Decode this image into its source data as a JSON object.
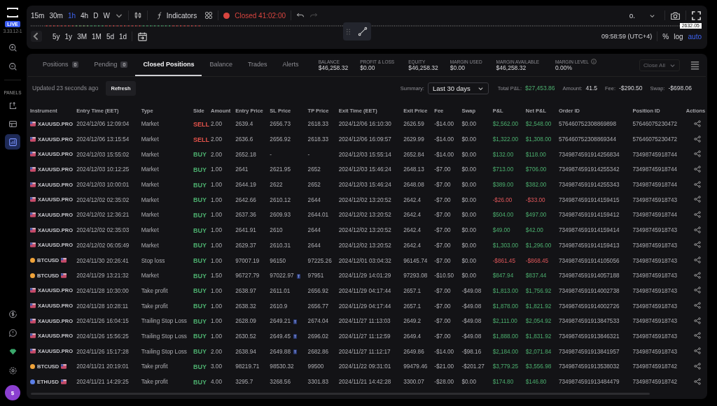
{
  "sidebar": {
    "badge": "LIVE",
    "version": "3.33.12-1",
    "section_label": "PANELS",
    "panel_items": [
      {
        "selected": false
      },
      {
        "selected": false
      },
      {
        "selected": true
      }
    ],
    "account": "$"
  },
  "toolbar": {
    "timeframes": [
      {
        "label": "15m",
        "selected": false
      },
      {
        "label": "30m",
        "selected": false
      },
      {
        "label": "1h",
        "selected": true
      },
      {
        "label": "4h",
        "selected": false
      },
      {
        "label": "D",
        "selected": false
      },
      {
        "label": "W",
        "selected": false
      }
    ],
    "indicators": "Indicators",
    "market_status": "Closed 41:02:00",
    "symbol_select": "o.",
    "price_label": "2632.05",
    "ranges": [
      "5y",
      "1y",
      "3M",
      "1M",
      "5d",
      "1d"
    ],
    "clock": "09:58:59 (UTC+4)",
    "scale_options": [
      {
        "label": "%",
        "selected": false
      },
      {
        "label": "log",
        "selected": false
      },
      {
        "label": "auto",
        "selected": true
      }
    ]
  },
  "panel": {
    "tabs": [
      {
        "label": "Positions",
        "count": "0",
        "selected": false
      },
      {
        "label": "Pending",
        "count": "0",
        "selected": false
      },
      {
        "label": "Closed Positions",
        "selected": true
      },
      {
        "label": "Balance",
        "selected": false
      },
      {
        "label": "Trades",
        "selected": false
      },
      {
        "label": "Alerts",
        "selected": false
      }
    ],
    "stats": [
      {
        "label": "BALANCE",
        "value": "$46,258.32"
      },
      {
        "label": "PROFIT & LOSS",
        "value": "$0.00"
      },
      {
        "label": "EQUITY",
        "value": "$46,258.32"
      },
      {
        "label": "MARGIN USED",
        "value": "$0.00"
      },
      {
        "label": "MARGIN AVAILABLE",
        "value": "$46,258.32"
      },
      {
        "label": "MARGIN LEVEL",
        "value": "0.00%",
        "info": true
      }
    ],
    "close_all": {
      "label": "Close All",
      "disabled": true
    },
    "updated": "Updated 23 seconds ago",
    "refresh": "Refresh",
    "summary": {
      "label": "Summary:",
      "period": "Last 30 days",
      "items": [
        {
          "label": "Total P&L:",
          "value": "$27,453.86",
          "positive": true
        },
        {
          "label": "Amount:",
          "value": "41.5",
          "positive": false
        },
        {
          "label": "Fee:",
          "value": "-$290.50",
          "positive": false
        },
        {
          "label": "Swap:",
          "value": "-$698.06",
          "positive": false
        }
      ]
    }
  },
  "table": {
    "columns": [
      "Instrument",
      "Entry Time (EET)",
      "Type",
      "Side",
      "Amount",
      "Entry Price",
      "SL Price",
      "TP Price",
      "Exit Time (EET)",
      "Exit Price",
      "Fee",
      "Swap",
      "P&L",
      "Net P&L",
      "Order ID",
      "Position ID",
      "Actions"
    ],
    "rows": [
      {
        "instrument": "XAUUSD.PRO",
        "kind": "metal",
        "entry_time": "2024/12/06 12:09:04",
        "type": "Market",
        "side": {
          "label": "SELL",
          "color": "#e5534b"
        },
        "amount": "2.00",
        "entry_price": "2639.4",
        "sl": "2656.73",
        "trailing": false,
        "tp": "2618.33",
        "exit_time": "2024/12/06 16:10:30",
        "exit_price": "2626.59",
        "fee": "-$14.00",
        "swap": "$0.00",
        "pnl": "$2,562.00",
        "net_pnl": "$2,548.00",
        "loss": false,
        "order_id": "576460752308869898",
        "position_id": "57646075230472"
      },
      {
        "instrument": "XAUUSD.PRO",
        "kind": "metal",
        "entry_time": "2024/12/06 13:15:54",
        "type": "Market",
        "side": {
          "label": "SELL",
          "color": "#e5534b"
        },
        "amount": "2.00",
        "entry_price": "2636.6",
        "sl": "2656.92",
        "trailing": false,
        "tp": "2618.33",
        "exit_time": "2024/12/06 16:09:57",
        "exit_price": "2629.99",
        "fee": "-$14.00",
        "swap": "$0.00",
        "pnl": "$1,322.00",
        "net_pnl": "$1,308.00",
        "loss": false,
        "order_id": "576460752308869344",
        "position_id": "57646075230472"
      },
      {
        "instrument": "XAUUSD.PRO",
        "kind": "metal",
        "entry_time": "2024/12/03 15:55:02",
        "type": "Market",
        "side": {
          "label": "BUY",
          "color": "#4cae6e"
        },
        "amount": "2.00",
        "entry_price": "2652.18",
        "sl": "-",
        "trailing": false,
        "tp": "-",
        "exit_time": "2024/12/03 15:55:14",
        "exit_price": "2652.84",
        "fee": "-$14.00",
        "swap": "$0.00",
        "pnl": "$132.00",
        "net_pnl": "$118.00",
        "loss": false,
        "order_id": "7349874591914256834",
        "position_id": "73498745918744"
      },
      {
        "instrument": "XAUUSD.PRO",
        "kind": "metal",
        "entry_time": "2024/12/03 10:12:25",
        "type": "Market",
        "side": {
          "label": "BUY",
          "color": "#4cae6e"
        },
        "amount": "1.00",
        "entry_price": "2641",
        "sl": "2621.95",
        "trailing": false,
        "tp": "2652",
        "exit_time": "2024/12/03 15:46:24",
        "exit_price": "2648.13",
        "fee": "-$7.00",
        "swap": "$0.00",
        "pnl": "$713.00",
        "net_pnl": "$706.00",
        "loss": false,
        "order_id": "7349874591914255342",
        "position_id": "73498745918744"
      },
      {
        "instrument": "XAUUSD.PRO",
        "kind": "metal",
        "entry_time": "2024/12/03 10:00:01",
        "type": "Market",
        "side": {
          "label": "BUY",
          "color": "#4cae6e"
        },
        "amount": "1.00",
        "entry_price": "2644.19",
        "sl": "2622",
        "trailing": false,
        "tp": "2652",
        "exit_time": "2024/12/03 15:46:24",
        "exit_price": "2648.08",
        "fee": "-$7.00",
        "swap": "$0.00",
        "pnl": "$389.00",
        "net_pnl": "$382.00",
        "loss": false,
        "order_id": "7349874591914255343",
        "position_id": "73498745918744"
      },
      {
        "instrument": "XAUUSD.PRO",
        "kind": "metal",
        "entry_time": "2024/12/02 02:35:02",
        "type": "Market",
        "side": {
          "label": "BUY",
          "color": "#4cae6e"
        },
        "amount": "1.00",
        "entry_price": "2642.66",
        "sl": "2610.12",
        "trailing": false,
        "tp": "2644",
        "exit_time": "2024/12/02 13:20:52",
        "exit_price": "2642.4",
        "fee": "-$7.00",
        "swap": "$0.00",
        "pnl": "-$26.00",
        "net_pnl": "-$33.00",
        "loss": true,
        "order_id": "7349874591914159415",
        "position_id": "73498745918743"
      },
      {
        "instrument": "XAUUSD.PRO",
        "kind": "metal",
        "entry_time": "2024/12/02 12:36:21",
        "type": "Market",
        "side": {
          "label": "BUY",
          "color": "#4cae6e"
        },
        "amount": "1.00",
        "entry_price": "2637.36",
        "sl": "2609.93",
        "trailing": false,
        "tp": "2644.01",
        "exit_time": "2024/12/02 13:20:52",
        "exit_price": "2642.4",
        "fee": "-$7.00",
        "swap": "$0.00",
        "pnl": "$504.00",
        "net_pnl": "$497.00",
        "loss": false,
        "order_id": "7349874591914159412",
        "position_id": "73498745918744"
      },
      {
        "instrument": "XAUUSD.PRO",
        "kind": "metal",
        "entry_time": "2024/12/02 02:35:03",
        "type": "Market",
        "side": {
          "label": "BUY",
          "color": "#4cae6e"
        },
        "amount": "1.00",
        "entry_price": "2641.91",
        "sl": "2610",
        "trailing": false,
        "tp": "2644",
        "exit_time": "2024/12/02 13:20:52",
        "exit_price": "2642.4",
        "fee": "-$7.00",
        "swap": "$0.00",
        "pnl": "$49.00",
        "net_pnl": "$42.00",
        "loss": false,
        "order_id": "7349874591914159414",
        "position_id": "73498745918743"
      },
      {
        "instrument": "XAUUSD.PRO",
        "kind": "metal",
        "entry_time": "2024/12/02 06:05:49",
        "type": "Market",
        "side": {
          "label": "BUY",
          "color": "#4cae6e"
        },
        "amount": "1.00",
        "entry_price": "2629.37",
        "sl": "2610.31",
        "trailing": false,
        "tp": "2644",
        "exit_time": "2024/12/02 13:20:52",
        "exit_price": "2642.4",
        "fee": "-$7.00",
        "swap": "$0.00",
        "pnl": "$1,303.00",
        "net_pnl": "$1,296.00",
        "loss": false,
        "order_id": "7349874591914159413",
        "position_id": "73498745918743"
      },
      {
        "instrument": "BTCUSD",
        "kind": "crypto",
        "color": "#f0a33a",
        "entry_time": "2024/11/30 20:26:41",
        "type": "Stop loss",
        "side": {
          "label": "BUY",
          "color": "#4cae6e"
        },
        "amount": "1.00",
        "entry_price": "97007.19",
        "sl": "96150",
        "trailing": false,
        "tp": "97225.26",
        "exit_time": "2024/12/01 03:04:32",
        "exit_price": "96145.74",
        "fee": "-$7.00",
        "swap": "$0.00",
        "pnl": "-$861.45",
        "net_pnl": "-$868.45",
        "loss": true,
        "order_id": "7349874591914105056",
        "position_id": "73498745918743"
      },
      {
        "instrument": "BTCUSD",
        "kind": "crypto",
        "color": "#f0a33a",
        "entry_time": "2024/11/29 13:21:32",
        "type": "Market",
        "side": {
          "label": "BUY",
          "color": "#4cae6e"
        },
        "amount": "1.50",
        "entry_price": "96727.79",
        "sl": "97022.97",
        "trailing": true,
        "tp": "97951",
        "exit_time": "2024/11/29 14:01:29",
        "exit_price": "97293.08",
        "fee": "-$10.50",
        "swap": "$0.00",
        "pnl": "$847.94",
        "net_pnl": "$837.44",
        "loss": false,
        "order_id": "7349874591914057188",
        "position_id": "73498745918743"
      },
      {
        "instrument": "XAUUSD.PRO",
        "kind": "metal",
        "entry_time": "2024/11/28 10:30:00",
        "type": "Take profit",
        "side": {
          "label": "BUY",
          "color": "#4cae6e"
        },
        "amount": "1.00",
        "entry_price": "2638.97",
        "sl": "2611.01",
        "trailing": false,
        "tp": "2656.92",
        "exit_time": "2024/11/29 04:17:44",
        "exit_price": "2657.1",
        "fee": "-$7.00",
        "swap": "-$49.08",
        "pnl": "$1,813.00",
        "net_pnl": "$1,756.92",
        "loss": false,
        "order_id": "7349874591914002738",
        "position_id": "73498745918743"
      },
      {
        "instrument": "XAUUSD.PRO",
        "kind": "metal",
        "entry_time": "2024/11/28 10:28:11",
        "type": "Take profit",
        "side": {
          "label": "BUY",
          "color": "#4cae6e"
        },
        "amount": "1.00",
        "entry_price": "2638.32",
        "sl": "2610.9",
        "trailing": false,
        "tp": "2656.77",
        "exit_time": "2024/11/29 04:17:44",
        "exit_price": "2657.1",
        "fee": "-$7.00",
        "swap": "-$49.08",
        "pnl": "$1,878.00",
        "net_pnl": "$1,821.92",
        "loss": false,
        "order_id": "7349874591914002726",
        "position_id": "73498745918743"
      },
      {
        "instrument": "XAUUSD.PRO",
        "kind": "metal",
        "entry_time": "2024/11/26 16:04:15",
        "type": "Trailing Stop Loss",
        "side": {
          "label": "BUY",
          "color": "#4cae6e"
        },
        "amount": "1.00",
        "entry_price": "2628.09",
        "sl": "2649.21",
        "trailing": true,
        "tp": "2674.04",
        "exit_time": "2024/11/27 11:13:03",
        "exit_price": "2649.2",
        "fee": "-$7.00",
        "swap": "-$49.08",
        "pnl": "$2,111.00",
        "net_pnl": "$2,054.92",
        "loss": false,
        "order_id": "7349874591913847533",
        "position_id": "73498745918743"
      },
      {
        "instrument": "XAUUSD.PRO",
        "kind": "metal",
        "entry_time": "2024/11/26 15:56:25",
        "type": "Trailing Stop Loss",
        "side": {
          "label": "BUY",
          "color": "#4cae6e"
        },
        "amount": "1.00",
        "entry_price": "2630.52",
        "sl": "2649.45",
        "trailing": true,
        "tp": "2696.02",
        "exit_time": "2024/11/27 11:12:59",
        "exit_price": "2649.4",
        "fee": "-$7.00",
        "swap": "-$49.08",
        "pnl": "$1,888.00",
        "net_pnl": "$1,831.92",
        "loss": false,
        "order_id": "7349874591913846321",
        "position_id": "73498745918743"
      },
      {
        "instrument": "XAUUSD.PRO",
        "kind": "metal",
        "entry_time": "2024/11/26 15:17:28",
        "type": "Trailing Stop Loss",
        "side": {
          "label": "BUY",
          "color": "#4cae6e"
        },
        "amount": "2.00",
        "entry_price": "2638.94",
        "sl": "2649.88",
        "trailing": true,
        "tp": "2682.86",
        "exit_time": "2024/11/27 11:12:17",
        "exit_price": "2649.86",
        "fee": "-$14.00",
        "swap": "-$98.16",
        "pnl": "$2,184.00",
        "net_pnl": "$2,071.84",
        "loss": false,
        "order_id": "7349874591913841957",
        "position_id": "73498745918743"
      },
      {
        "instrument": "BTCUSD",
        "kind": "crypto",
        "color": "#f0a33a",
        "entry_time": "2024/11/21 20:19:01",
        "type": "Take profit",
        "side": {
          "label": "BUY",
          "color": "#4cae6e"
        },
        "amount": "3.00",
        "entry_price": "98219.71",
        "sl": "98530.32",
        "trailing": false,
        "tp": "99500",
        "exit_time": "2024/11/22 09:31:01",
        "exit_price": "99479.46",
        "fee": "-$21.00",
        "swap": "-$201.27",
        "pnl": "$3,779.25",
        "net_pnl": "$3,556.98",
        "loss": false,
        "order_id": "7349874591913538032",
        "position_id": "73498745918742"
      },
      {
        "instrument": "ETHUSD",
        "kind": "crypto",
        "color": "#5b7fe8",
        "entry_time": "2024/11/21 14:29:25",
        "type": "Take profit",
        "side": {
          "label": "BUY",
          "color": "#4cae6e"
        },
        "amount": "4.00",
        "entry_price": "3295.7",
        "sl": "3268.56",
        "trailing": false,
        "tp": "3301.83",
        "exit_time": "2024/11/21 14:42:28",
        "exit_price": "3300.07",
        "fee": "-$28.00",
        "swap": "$0.00",
        "pnl": "$174.80",
        "net_pnl": "$146.80",
        "loss": false,
        "order_id": "7349874591913484479",
        "position_id": "73498745918742"
      }
    ]
  }
}
